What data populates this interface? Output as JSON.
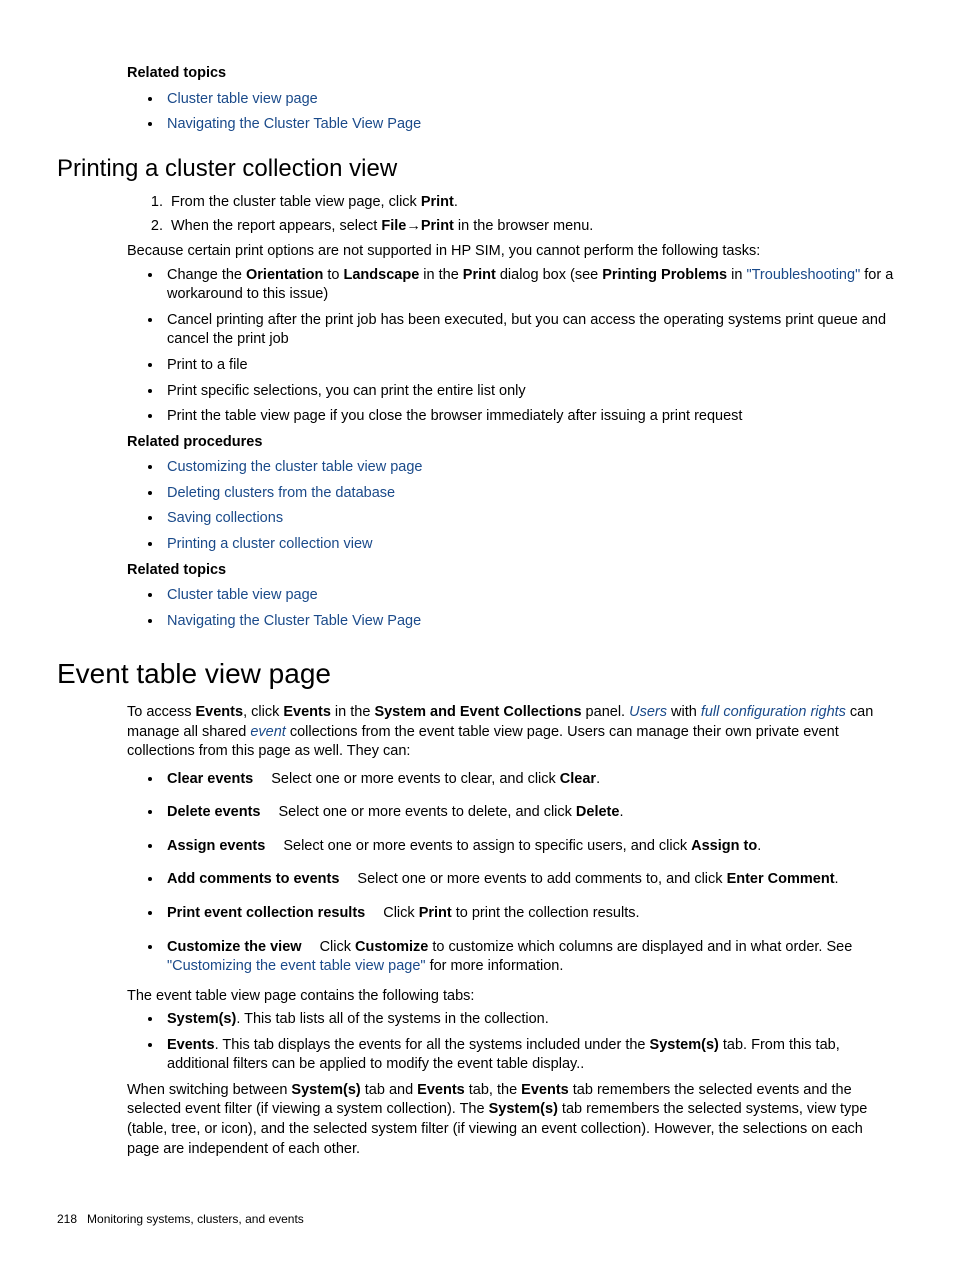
{
  "related_topics_label": "Related topics",
  "related_procedures_label": "Related procedures",
  "top_related_topics": [
    "Cluster table view page",
    "Navigating the Cluster Table View Page"
  ],
  "section_printing": {
    "heading": "Printing a cluster collection view",
    "step1_prefix": "From the cluster table view page, click ",
    "step1_bold": "Print",
    "step1_suffix": ".",
    "step2_prefix": "When the report appears, select ",
    "step2_file": "File",
    "step2_print": "Print",
    "step2_suffix": " in the browser menu.",
    "intro_after_steps": "Because certain print options are not supported in HP SIM, you cannot perform the following tasks:",
    "bullet1_a": "Change the ",
    "bullet1_b": "Orientation",
    "bullet1_c": " to ",
    "bullet1_d": "Landscape",
    "bullet1_e": " in the ",
    "bullet1_f": "Print",
    "bullet1_g": " dialog box (see ",
    "bullet1_h": "Printing Problems",
    "bullet1_i": " in ",
    "bullet1_link": "\"Troubleshooting\"",
    "bullet1_j": " for a workaround to this issue)",
    "bullet2": "Cancel printing after the print job has been executed, but you can access the operating systems print queue and cancel the print job",
    "bullet3": "Print to a file",
    "bullet4": "Print specific selections, you can print the entire list only",
    "bullet5": "Print the table view page if you close the browser immediately after issuing a print request",
    "related_procedures": [
      "Customizing the cluster table view page",
      "Deleting clusters from the database",
      "Saving collections",
      "Printing a cluster collection view"
    ],
    "related_topics": [
      "Cluster table view page",
      "Navigating the Cluster Table View Page"
    ]
  },
  "section_event": {
    "heading": "Event table view page",
    "p1_a": "To access ",
    "p1_b": "Events",
    "p1_c": ", click ",
    "p1_d": "Events",
    "p1_e": " in the ",
    "p1_f": "System and Event Collections",
    "p1_g": " panel. ",
    "p1_users": "Users",
    "p1_h": " with ",
    "p1_fcr": "full configuration rights",
    "p1_i": " can manage all shared ",
    "p1_event": "event",
    "p1_j": " collections from the event table view page. Users can manage their own private event collections from this page as well. They can:",
    "act1_t": "Clear events",
    "act1_a": "Select one or more events to clear, and click ",
    "act1_b": "Clear",
    "act1_c": ".",
    "act2_t": "Delete events",
    "act2_a": "Select one or more events to delete, and click ",
    "act2_b": "Delete",
    "act2_c": ".",
    "act3_t": "Assign events",
    "act3_a": "Select one or more events to assign to specific users, and click ",
    "act3_b": "Assign to",
    "act3_c": ".",
    "act4_t": "Add comments to events",
    "act4_a": "Select one or more events to add comments to, and click ",
    "act4_b": "Enter Comment",
    "act4_c": ".",
    "act5_t": "Print event collection results",
    "act5_a": "Click ",
    "act5_b": "Print",
    "act5_c": " to print the collection results.",
    "act6_t": "Customize the view",
    "act6_a": "Click ",
    "act6_b": "Customize",
    "act6_c": " to customize which columns are displayed and in what order. See ",
    "act6_link": "\"Customizing the event table view page\"",
    "act6_d": " for more information.",
    "tabs_intro": "The event table view page contains the following tabs:",
    "tab1_t": "System(s)",
    "tab1_a": ". This tab lists all of the systems in the collection.",
    "tab2_t": "Events",
    "tab2_a": ". This tab displays the events for all the systems included under the ",
    "tab2_b": "System(s)",
    "tab2_c": " tab. From this tab, additional filters can be applied to modify the event table display..",
    "p_last_a": "When switching between ",
    "p_last_b": "System(s)",
    "p_last_c": " tab and ",
    "p_last_d": "Events",
    "p_last_e": " tab, the ",
    "p_last_f": "Events",
    "p_last_g": " tab remembers the selected events and the selected event filter (if viewing a system collection). The ",
    "p_last_h": "System(s)",
    "p_last_i": " tab remembers the selected systems, view type (table, tree, or icon), and the selected system filter (if viewing an event collection). However, the selections on each page are independent of each other."
  },
  "footer": {
    "page_number": "218",
    "chapter": "Monitoring systems, clusters, and events"
  }
}
